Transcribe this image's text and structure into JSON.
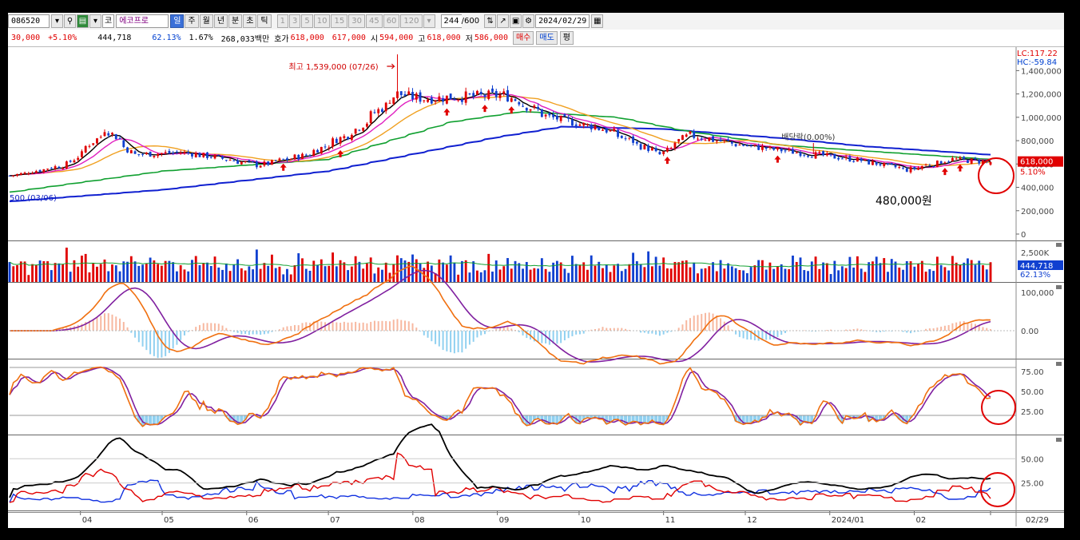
{
  "toolbar": {
    "code": "086520",
    "market": "코",
    "name": "에코프로",
    "periods": [
      "일",
      "주",
      "월",
      "년",
      "분",
      "초",
      "틱"
    ],
    "selected_period": "일",
    "intervals": [
      "1",
      "3",
      "5",
      "10",
      "15",
      "30",
      "45",
      "60",
      "120"
    ],
    "count": "244",
    "count_max": "/600",
    "date": "2024/02/29"
  },
  "quote": {
    "change": "30,000",
    "change_pct": "+5.10%",
    "volume": "444,718",
    "volume_ratio": "62.13%",
    "turnover_pct": "1.67%",
    "amount": "268,033백만",
    "hoga_label": "호가",
    "ask": "618,000",
    "bid": "617,000",
    "open_label": "시",
    "open": "594,000",
    "high_label": "고",
    "high": "618,000",
    "low_label": "저",
    "low": "586,000",
    "buy": "매수",
    "sell": "매도",
    "eval": "평"
  },
  "colors": {
    "up": "#e00000",
    "down": "#1040d0",
    "ma5": "#000000",
    "ma10": "#e020c0",
    "ma20": "#f0a020",
    "ma60": "#10a030",
    "ma120": "#1020d0",
    "macd": "#f07010",
    "macd_signal": "#8020a0",
    "osc_pos": "#f7b8a0",
    "osc_neg": "#90d0f0",
    "stoch_k": "#f07010",
    "stoch_d": "#8020a0",
    "dmi_pdi": "#e00000",
    "dmi_mdi": "#1030e0",
    "adx": "#000000",
    "highlight": "#e00000"
  },
  "chart_data": [
    {
      "type": "candlestick",
      "panel": "price",
      "x_start": "2023-03-06",
      "x_end": "2024-02-29",
      "ylim": [
        0,
        1560000
      ],
      "y_ticks": [
        0,
        200000,
        400000,
        600000,
        800000,
        1000000,
        1200000,
        1400000
      ],
      "y_tick_labels": [
        "0",
        "200,000",
        "400,000",
        "600,000",
        "800,000",
        "1,000,000",
        "1,200,000",
        "1,400,000"
      ],
      "x_labels": [
        "04",
        "05",
        "06",
        "07",
        "08",
        "09",
        "10",
        "11",
        "12",
        "2024/01",
        "02",
        "02/29"
      ],
      "x_label_dates": [
        "2023-04-01",
        "2023-05-01",
        "2023-06-01",
        "2023-07-01",
        "2023-08-01",
        "2023-09-01",
        "2023-10-01",
        "2023-11-01",
        "2023-12-01",
        "2024-01-01",
        "2024-02-01",
        "2024-02-29"
      ],
      "series": [
        {
          "name": "close",
          "values": [
            [
              "2023-03-06",
              500000
            ],
            [
              "2023-03-27",
              600000
            ],
            [
              "2023-04-10",
              900000
            ],
            [
              "2023-04-20",
              680000
            ],
            [
              "2023-05-08",
              700000
            ],
            [
              "2023-05-22",
              650000
            ],
            [
              "2023-06-05",
              590000
            ],
            [
              "2023-06-23",
              680000
            ],
            [
              "2023-07-10",
              880000
            ],
            [
              "2023-07-26",
              1200000
            ],
            [
              "2023-08-04",
              1160000
            ],
            [
              "2023-08-22",
              1180000
            ],
            [
              "2023-09-04",
              1190000
            ],
            [
              "2023-09-20",
              1000000
            ],
            [
              "2023-10-10",
              900000
            ],
            [
              "2023-10-31",
              680000
            ],
            [
              "2023-11-10",
              850000
            ],
            [
              "2023-11-30",
              760000
            ],
            [
              "2023-12-20",
              700000
            ],
            [
              "2024-01-10",
              640000
            ],
            [
              "2024-01-30",
              550000
            ],
            [
              "2024-02-15",
              640000
            ],
            [
              "2024-02-29",
              618000
            ]
          ]
        },
        {
          "name": "ma120",
          "values": [
            [
              "2023-03-06",
              280000
            ],
            [
              "2023-05-01",
              380000
            ],
            [
              "2023-07-01",
              540000
            ],
            [
              "2023-09-01",
              830000
            ],
            [
              "2023-09-25",
              920000
            ],
            [
              "2023-11-01",
              900000
            ],
            [
              "2023-12-15",
              820000
            ],
            [
              "2024-01-15",
              750000
            ],
            [
              "2024-02-29",
              680000
            ]
          ]
        },
        {
          "name": "ma60",
          "values": [
            [
              "2023-03-06",
              360000
            ],
            [
              "2023-05-01",
              540000
            ],
            [
              "2023-07-01",
              640000
            ],
            [
              "2023-08-15",
              960000
            ],
            [
              "2023-09-10",
              1050000
            ],
            [
              "2023-10-15",
              1000000
            ],
            [
              "2023-11-10",
              880000
            ],
            [
              "2023-12-15",
              760000
            ],
            [
              "2024-02-29",
              640000
            ]
          ]
        }
      ],
      "annotations": [
        {
          "text": "최고 1,539,000 (07/26)",
          "date": "2023-07-26",
          "value": 1539000
        },
        {
          "text": "배당락(0.00%)",
          "date": "2023-12-26",
          "value": 760000
        },
        {
          "text": "500 (03/06)",
          "date": "2023-03-06",
          "value": 500
        },
        {
          "text": "480,000원",
          "date": "2024-02-05",
          "value": 480000
        }
      ],
      "current": {
        "price": "618,000",
        "change_pct": "5.10%"
      },
      "lc": "LC:117.22",
      "hc": "HC:-59.84"
    },
    {
      "type": "bar",
      "panel": "volume",
      "y_tick_labels": [
        "2,500K"
      ],
      "current": "444,718",
      "ratio": "62.13%"
    },
    {
      "type": "line",
      "panel": "macd",
      "y_tick_labels": [
        "100,000",
        "0.00"
      ],
      "ylim": [
        -60000,
        110000
      ]
    },
    {
      "type": "line",
      "panel": "stochastic",
      "ylim": [
        0,
        85
      ],
      "y_tick_labels": [
        "75.00",
        "50.00",
        "25.00"
      ]
    },
    {
      "type": "line",
      "panel": "dmi",
      "ylim": [
        0,
        70
      ],
      "y_tick_labels": [
        "50.00",
        "25.00"
      ]
    }
  ]
}
